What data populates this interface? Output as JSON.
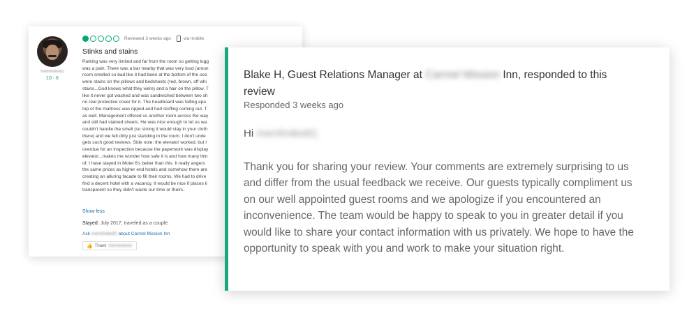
{
  "review": {
    "reviewer_name": "merrilmike82",
    "reviewer_stats": "10 · 6",
    "rating_bubbles": 1,
    "rating_max": 5,
    "review_date": "Reviewed 3 weeks ago",
    "via": "via mobile",
    "title": "Stinks and stains",
    "body_lines": [
      "Parking was very limited and far from the room so getting lugg",
      "was a pain. There was a bar nearby that was very loud (aroun",
      "room smelled so bad like it had been at the bottom of the oce",
      "were stains on the pillows and bedsheets (red, brown, off whi",
      "stains...God knows what they were) and a hair on the pillow. T",
      "like it never got washed and was sandwiched between two sh",
      "no real protective cover for it. The headboard was falling apa",
      "top of the mattress was ripped and had stuffing coming out. T",
      "as well. Management offered us another room across the way",
      "and still had stained sheets. He was nice enough to let us wa",
      "couldn't handle the smell (so strong it would stay in your cloth",
      "there) and we felt dirty just standing in the room. I don't unde",
      "gets such good reviews. Side note: the elevator worked, but I",
      "overdue for an inspection because the paperwork was display",
      "elevator...makes me wonder how safe it is and how many thin",
      "of. I have stayed in Motel 6's better than this. It really angers",
      "the same prices as higher end hotels and somehow there are",
      "creating an alluring facade to fill their rooms. We had to drive",
      "find a decent hotel with a vacancy. It would be nice if places li",
      "transparent so they didn't waste our time or theirs."
    ],
    "show_less": "Show less",
    "stayed_label": "Stayed:",
    "stayed_value": "July 2017, traveled as a couple",
    "ask_prefix": "Ask",
    "ask_name": "merrilmike82",
    "ask_suffix": "about Carmel Mission Inn",
    "thank_label": "Thank",
    "thank_name": "merrilmike82"
  },
  "response": {
    "responder_prefix": "Blake H, Guest Relations Manager at",
    "hotel_name": "Carmel Mission",
    "responder_suffix": "Inn, responded to this review",
    "responded_date": "Responded 3 weeks ago",
    "greeting_prefix": "Hi",
    "greeting_name": "merrilmike82,",
    "body": "Thank you for sharing your review. Your comments are extremely surprising to us and differ from the usual feedback we receive. Our guests typically compliment us on our well appointed guest rooms and we apologize if you encountered an inconvenience. The team would be happy to speak to you in greater detail if you would like to share your contact information with us privately. We hope to have the opportunity to speak with you and work to make your situation right."
  },
  "colors": {
    "accent_green": "#1aa77e",
    "rating_green": "#00aa6c",
    "link_blue": "#1a6fb0"
  }
}
